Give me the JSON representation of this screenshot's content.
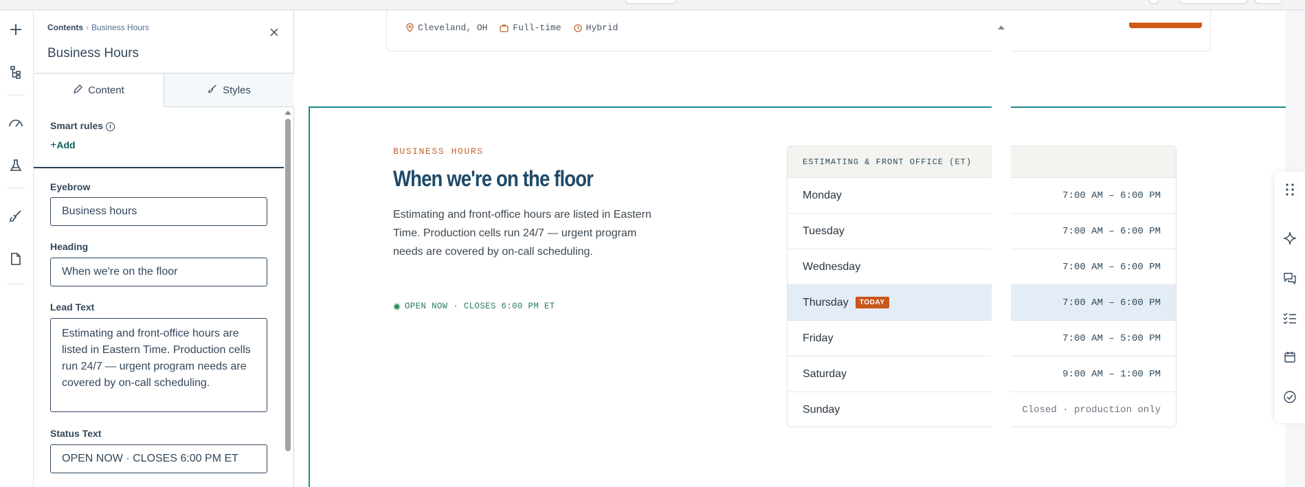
{
  "panel": {
    "breadcrumb_root": "Contents",
    "breadcrumb_current": "Business Hours",
    "title": "Business Hours",
    "tabs": [
      {
        "label": "Content",
        "icon": "pencil-icon"
      },
      {
        "label": "Styles",
        "icon": "brush-icon"
      }
    ],
    "smart_rules_label": "Smart rules",
    "add_label": "Add",
    "fields": {
      "eyebrow_label": "Eyebrow",
      "eyebrow_value": "Business hours",
      "heading_label": "Heading",
      "heading_value": "When we're on the floor",
      "lead_label": "Lead Text",
      "lead_value": "Estimating and front-office hours are listed in Eastern Time. Production cells run 24/7 — urgent program needs are covered by on-call scheduling.",
      "status_label": "Status Text",
      "status_value": "OPEN NOW · CLOSES 6:00 PM ET"
    }
  },
  "rail": {
    "icons": [
      "plus-icon",
      "tree-icon",
      "gauge-icon",
      "flask-icon",
      "brush-icon",
      "page-icon"
    ]
  },
  "job": {
    "location": "Cleveland, OH",
    "type": "Full-time",
    "mode": "Hybrid"
  },
  "section": {
    "eyebrow": "BUSINESS HOURS",
    "heading": "When we're on the floor",
    "lead": "Estimating and front-office hours are listed in Eastern Time. Production cells run 24/7 — urgent program needs are covered by on-call scheduling.",
    "status": "OPEN NOW · CLOSES 6:00 PM ET",
    "hours_title": "ESTIMATING & FRONT OFFICE (ET)",
    "today_badge": "TODAY",
    "hours": [
      {
        "day": "Monday",
        "time": "7:00 AM – 6:00 PM"
      },
      {
        "day": "Tuesday",
        "time": "7:00 AM – 6:00 PM"
      },
      {
        "day": "Wednesday",
        "time": "7:00 AM – 6:00 PM"
      },
      {
        "day": "Thursday",
        "time": "7:00 AM – 6:00 PM"
      },
      {
        "day": "Friday",
        "time": "7:00 AM – 5:00 PM"
      },
      {
        "day": "Saturday",
        "time": "9:00 AM – 1:00 PM"
      },
      {
        "day": "Sunday",
        "time": "Closed · production only"
      }
    ]
  },
  "toolbar": {
    "icons": [
      "drag-handle-icon",
      "sparkle-icon",
      "comments-icon",
      "checklist-icon",
      "calendar-icon",
      "check-circle-icon"
    ]
  },
  "colors": {
    "accent_orange": "#c2632c",
    "heading_navy": "#1f4a69",
    "selection_teal": "#1c8a8d",
    "open_green": "#2e7d5b",
    "today_bg": "#e4ecf6"
  }
}
